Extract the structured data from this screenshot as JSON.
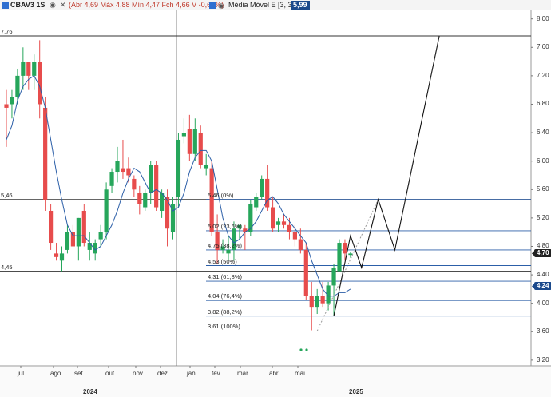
{
  "header": {
    "symbol": "CBAV3",
    "timeframe": "1S",
    "ohlc_text": "(Abr 4,69 Máx 4,88 Mín 4,47 Fch 4,66 V -0,64%)",
    "indicator_label": "Média Móvel E [3, 3]",
    "indicator_value": "5,99"
  },
  "colors": {
    "up": "#26a65b",
    "down": "#e74c4c",
    "ma": "#2c5fa8",
    "badge": "#1c4a8c"
  },
  "icons": [
    "eye-icon",
    "close-icon"
  ],
  "price_axis": {
    "labels": [
      "8,00",
      "7,60",
      "7,20",
      "6,80",
      "6,40",
      "6,00",
      "5,60",
      "5,20",
      "4,80",
      "4,40",
      "4,00",
      "3,60",
      "3,20"
    ],
    "last_price": "4,70",
    "ma_price": "4,24"
  },
  "time_axis": {
    "months": [
      "jul",
      "ago",
      "set",
      "out",
      "nov",
      "dez",
      "jan",
      "fev",
      "mar",
      "abr",
      "mai"
    ],
    "years": [
      "2024",
      "2025"
    ]
  },
  "horizontal_levels": [
    "7,76",
    "5,46",
    "4,45"
  ],
  "fibonacci": [
    {
      "label": "5,46 (0%)"
    },
    {
      "label": "5,02 (23,6%)"
    },
    {
      "label": "4,75 (38,2%)"
    },
    {
      "label": "4,53 (50%)"
    },
    {
      "label": "4,31 (61,8%)"
    },
    {
      "label": "4,04 (76,4%)"
    },
    {
      "label": "3,82 (88,2%)"
    },
    {
      "label": "3,61 (100%)"
    }
  ],
  "chart_data": {
    "type": "candlestick",
    "series": [
      {
        "name": "CBAV3 1S",
        "ohlc": [
          [
            6.8,
            7.0,
            6.2,
            6.75
          ],
          [
            6.8,
            7.0,
            6.6,
            6.9
          ],
          [
            6.9,
            7.3,
            6.8,
            7.2
          ],
          [
            7.2,
            7.6,
            7.0,
            7.4
          ],
          [
            7.4,
            7.4,
            7.0,
            7.2
          ],
          [
            7.2,
            7.5,
            7.0,
            7.4
          ],
          [
            7.4,
            7.7,
            6.6,
            6.8
          ],
          [
            6.75,
            6.9,
            5.3,
            5.45
          ],
          [
            5.3,
            5.4,
            4.75,
            4.85
          ],
          [
            4.7,
            4.85,
            4.6,
            4.65
          ],
          [
            4.6,
            4.8,
            4.45,
            4.7
          ],
          [
            4.75,
            5.1,
            4.7,
            5.0
          ],
          [
            5.0,
            5.1,
            4.8,
            4.8
          ],
          [
            4.8,
            5.2,
            4.6,
            5.2
          ],
          [
            5.3,
            5.4,
            4.8,
            4.85
          ],
          [
            4.75,
            5.0,
            4.6,
            4.85
          ],
          [
            4.7,
            4.9,
            4.6,
            4.85
          ],
          [
            4.9,
            5.1,
            4.8,
            5.0
          ],
          [
            5.0,
            5.7,
            4.9,
            5.6
          ],
          [
            5.65,
            5.9,
            5.55,
            5.85
          ],
          [
            5.85,
            6.2,
            5.7,
            6.0
          ],
          [
            5.9,
            6.3,
            5.75,
            5.85
          ],
          [
            5.9,
            6.05,
            5.7,
            5.8
          ],
          [
            5.75,
            5.8,
            5.5,
            5.6
          ],
          [
            5.55,
            5.65,
            5.25,
            5.4
          ],
          [
            5.35,
            5.6,
            5.3,
            5.55
          ],
          [
            5.55,
            6.0,
            5.4,
            5.95
          ],
          [
            5.95,
            6.0,
            5.3,
            5.35
          ],
          [
            5.3,
            5.6,
            5.2,
            5.55
          ],
          [
            5.5,
            5.6,
            4.8,
            5.05
          ],
          [
            5.0,
            5.5,
            4.9,
            5.4
          ],
          [
            5.5,
            6.4,
            5.35,
            6.3
          ],
          [
            6.35,
            6.6,
            6.25,
            6.4
          ],
          [
            6.45,
            6.65,
            6.0,
            6.1
          ],
          [
            6.1,
            6.6,
            6.0,
            6.45
          ],
          [
            6.4,
            6.5,
            5.9,
            5.95
          ],
          [
            5.9,
            6.1,
            5.8,
            5.95
          ],
          [
            5.9,
            6.0,
            4.95,
            5.0
          ],
          [
            5.0,
            5.25,
            4.55,
            4.75
          ],
          [
            4.75,
            4.9,
            4.7,
            4.8
          ],
          [
            4.7,
            4.95,
            4.6,
            4.75
          ],
          [
            4.75,
            5.15,
            4.6,
            5.05
          ],
          [
            5.05,
            5.1,
            4.9,
            5.1
          ],
          [
            5.05,
            5.1,
            4.75,
            5.0
          ],
          [
            5.0,
            5.45,
            4.95,
            5.4
          ],
          [
            5.35,
            5.55,
            5.3,
            5.5
          ],
          [
            5.5,
            5.8,
            5.45,
            5.75
          ],
          [
            5.75,
            5.95,
            5.3,
            5.35
          ],
          [
            5.35,
            5.5,
            5.0,
            5.05
          ],
          [
            5.1,
            5.2,
            5.0,
            5.15
          ],
          [
            5.15,
            5.25,
            5.05,
            5.1
          ],
          [
            5.1,
            5.2,
            4.9,
            5.0
          ],
          [
            5.0,
            5.1,
            4.8,
            4.9
          ],
          [
            4.9,
            5.05,
            4.7,
            4.75
          ],
          [
            4.75,
            4.85,
            4.05,
            4.1
          ],
          [
            4.1,
            4.3,
            3.62,
            3.95
          ],
          [
            3.95,
            4.2,
            3.85,
            4.1
          ],
          [
            4.1,
            4.3,
            3.95,
            4.0
          ],
          [
            4.0,
            4.3,
            3.9,
            4.25
          ],
          [
            4.25,
            4.55,
            3.82,
            4.5
          ],
          [
            4.45,
            4.9,
            4.45,
            4.85
          ],
          [
            4.85,
            4.9,
            4.6,
            4.7
          ],
          [
            4.68,
            4.72,
            4.64,
            4.7
          ]
        ]
      }
    ],
    "moving_average": {
      "name": "Média Móvel E [3, 3]",
      "values": [
        6.3,
        6.5,
        6.85,
        7.05,
        7.15,
        7.2,
        7.05,
        6.75,
        6.3,
        5.85,
        5.45,
        5.1,
        4.95,
        4.95,
        4.95,
        4.85,
        4.75,
        4.8,
        4.95,
        5.1,
        5.3,
        5.55,
        5.75,
        5.9,
        5.85,
        5.7,
        5.55,
        5.6,
        5.55,
        5.45,
        5.3,
        5.35,
        5.55,
        5.85,
        6.05,
        6.15,
        6.15,
        6.0,
        5.6,
        5.2,
        4.95,
        4.85,
        4.9,
        5.0,
        5.05,
        5.15,
        5.3,
        5.45,
        5.5,
        5.4,
        5.25,
        5.15,
        5.05,
        4.95,
        4.85,
        4.6,
        4.4,
        4.2,
        4.1,
        4.1,
        4.15,
        4.15,
        4.2
      ]
    },
    "projection_line": [
      [
        59,
        3.82
      ],
      [
        62,
        4.95
      ],
      [
        64,
        4.5
      ],
      [
        67,
        5.46
      ],
      [
        70,
        4.75
      ],
      [
        78,
        7.76
      ]
    ],
    "dotted_line": [
      [
        56,
        3.61
      ],
      [
        67,
        5.46
      ]
    ],
    "y_axis": {
      "range": [
        3.12,
        8.12
      ],
      "scale": "linear"
    },
    "x_axis": {
      "type": "weekly"
    }
  }
}
